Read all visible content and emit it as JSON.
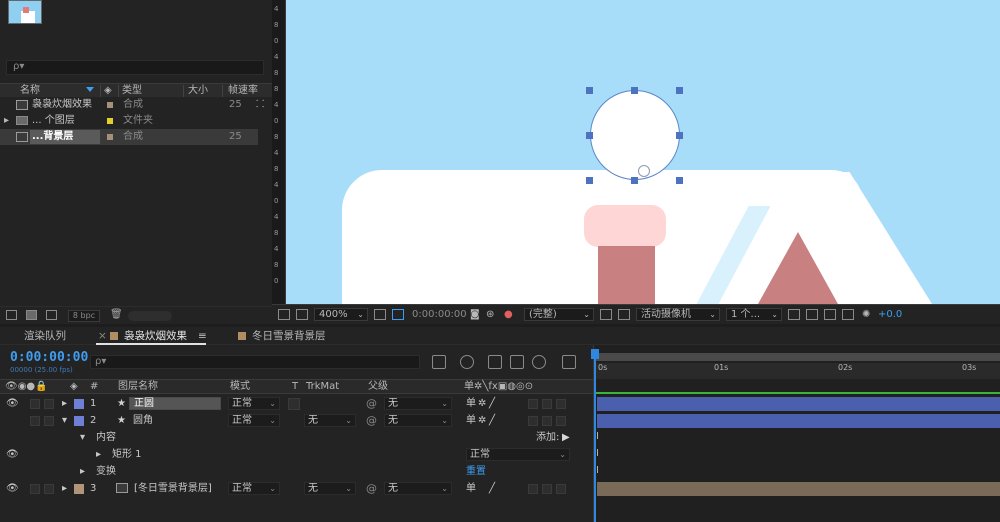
{
  "project": {
    "columns": {
      "name": "名称",
      "type": "类型",
      "size": "大小",
      "fps": "帧速率"
    },
    "items": [
      {
        "name": "袅袅炊烟效果",
        "type": "合成",
        "fps": "25",
        "swatch": "#a5917a"
      },
      {
        "name": "... 个图层",
        "type": "文件夹",
        "fps": "",
        "swatch": "#e0cf2d"
      },
      {
        "name": "...背景层",
        "type": "合成",
        "fps": "25",
        "swatch": "#a5917a"
      }
    ],
    "bpc": "8 bpc"
  },
  "viewer": {
    "ruler_ticks": [
      "4",
      "8",
      "0",
      "4",
      "8",
      "8",
      "4",
      "0",
      "8",
      "4",
      "8",
      "4",
      "0",
      "4",
      "8",
      "4",
      "8",
      "0"
    ],
    "zoom": "400%",
    "timecode": "0:00:00:00",
    "resolution": "(完整)",
    "camera": "活动摄像机",
    "views": "1 个...",
    "exposure": "+0.0",
    "colors": {
      "sky": "#a8ddfa",
      "roof": "#c98080",
      "chimney_top": "#ffd6d6"
    }
  },
  "tabs": {
    "render_queue": "渲染队列",
    "active": "袅袅炊烟效果",
    "other": "冬日雪景背景层",
    "menu_icon": "≡",
    "close_icon": "×"
  },
  "timeline": {
    "timecode": "0:00:00:00",
    "fps_sub": "00000 (25.00 fps)",
    "search_placeholder": "ρ▾",
    "headers": {
      "num": "#",
      "layer_name": "图层名称",
      "mode": "模式",
      "t": "T",
      "trkmat": "TrkMat",
      "parent": "父级"
    },
    "layers": [
      {
        "num": "1",
        "name": "正圆",
        "mode": "正常",
        "trkmat": "",
        "parent": "无",
        "color": "#6f7fd6",
        "bar": "#4a5fae"
      },
      {
        "num": "2",
        "name": "圆角",
        "mode": "正常",
        "trkmat": "无",
        "parent": "无",
        "color": "#6f7fd6",
        "bar": "#4a5fae"
      },
      {
        "num": "3",
        "name": "[冬日雪景背景层]",
        "mode": "正常",
        "trkmat": "无",
        "parent": "无",
        "color": "#b0957a",
        "bar": "#7a6a58"
      }
    ],
    "content_label": "内容",
    "add_label": "添加:",
    "rect_label": "矩形 1",
    "rect_mode": "正常",
    "transform_label": "变换",
    "reset_label": "重置",
    "ruler": [
      "0s",
      "01s",
      "02s",
      "03s"
    ]
  }
}
